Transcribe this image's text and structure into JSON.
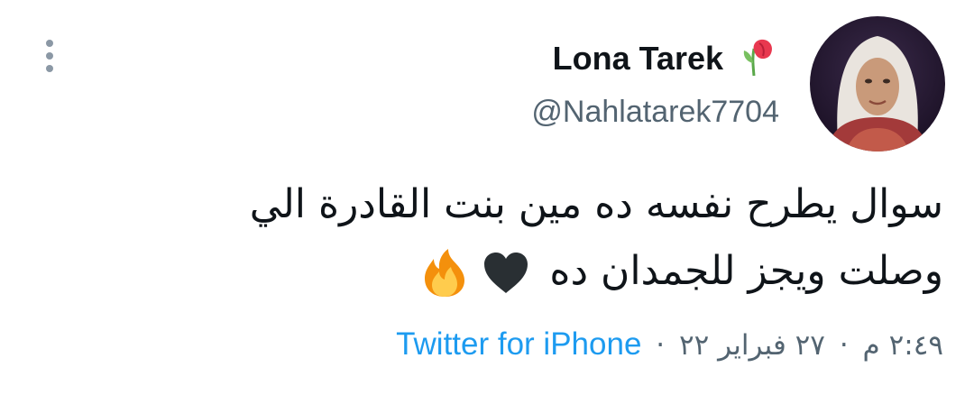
{
  "user": {
    "display_name": "Lona Tarek",
    "handle": "@Nahlatarek7704",
    "name_emoji": "wilted-flower",
    "avatar": "profile-photo"
  },
  "tweet": {
    "line1": "سوال يطرح نفسه ده مين بنت القادرة الي",
    "line2": "وصلت ويجز للجمدان ده",
    "emojis": [
      "black-heart",
      "fire"
    ]
  },
  "meta": {
    "time": "٢:٤٩ م",
    "separator": "·",
    "date": "٢٧ فبراير ٢٢",
    "source": "Twitter for iPhone"
  },
  "colors": {
    "text": "#0f1419",
    "secondary": "#536471",
    "link": "#1d9bf0"
  },
  "icons": {
    "more": "vertical-ellipsis-icon"
  }
}
